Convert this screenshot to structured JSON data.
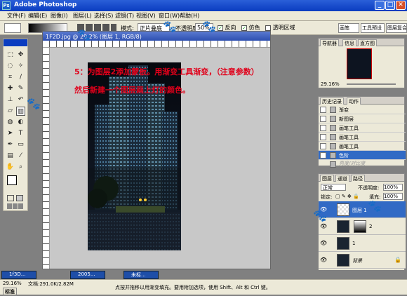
{
  "title_bar": {
    "title": "Adobe Photoshop",
    "minimize": "_",
    "maximize": "□",
    "close": "✕"
  },
  "menu": [
    "文件(F)",
    "编辑(E)",
    "图像(I)",
    "图层(L)",
    "选择(S)",
    "滤镜(T)",
    "视图(V)",
    "窗口(W)",
    "帮助(H)"
  ],
  "options": {
    "mode_label": "模式:",
    "mode_value": "正片叠底",
    "opacity_label": "不透明度:",
    "opacity_value": "50%",
    "reverse_label": "反向",
    "dither_label": "仿色",
    "transparency_label": "透明区域",
    "palette_tabs": [
      "画笔",
      "工具预设",
      "图层复合"
    ]
  },
  "annotation": {
    "line1": "5：为图层2添加蒙板。用渐变工具渐变，（注意参数）",
    "line2": "然后新建一个图层画上灯的颜色。"
  },
  "navigator": {
    "tabs": [
      "导航器",
      "信息",
      "直方图"
    ],
    "zoom": "29.16%"
  },
  "history": {
    "tabs": [
      "历史记录",
      "动作"
    ],
    "items": [
      {
        "label": "渐变",
        "state": "normal"
      },
      {
        "label": "新图层",
        "state": "normal"
      },
      {
        "label": "画笔工具",
        "state": "normal"
      },
      {
        "label": "画笔工具",
        "state": "normal"
      },
      {
        "label": "画笔工具",
        "state": "normal"
      },
      {
        "label": "色阶",
        "state": "selected"
      },
      {
        "label": "亮度/对比度",
        "state": "dim"
      }
    ]
  },
  "layers": {
    "tabs": [
      "图层",
      "通道",
      "路径"
    ],
    "blend_mode": "正常",
    "opacity_label": "不透明度:",
    "opacity_value": "100%",
    "lock_label": "锁定:",
    "fill_label": "填充:",
    "fill_value": "100%",
    "items": [
      {
        "name": "图层 1",
        "selected": true
      },
      {
        "name": "2",
        "selected": false
      },
      {
        "name": "1",
        "selected": false
      },
      {
        "name": "背景",
        "selected": false
      }
    ]
  },
  "taskbar": [
    "1f3D...",
    "2005...",
    "未标..."
  ],
  "status": {
    "zoom": "29.16%",
    "doc": "文档:291.0K/2.82M",
    "hint": "点按并拖移以用渐变填充。要用附加选项，使用 Shift、Alt 和 Ctrl 键。",
    "mode": "标准"
  },
  "colors": {
    "title_blue": "#0a3cc0",
    "annotation_red": "#e0001a",
    "selection_blue": "#316ac5"
  }
}
